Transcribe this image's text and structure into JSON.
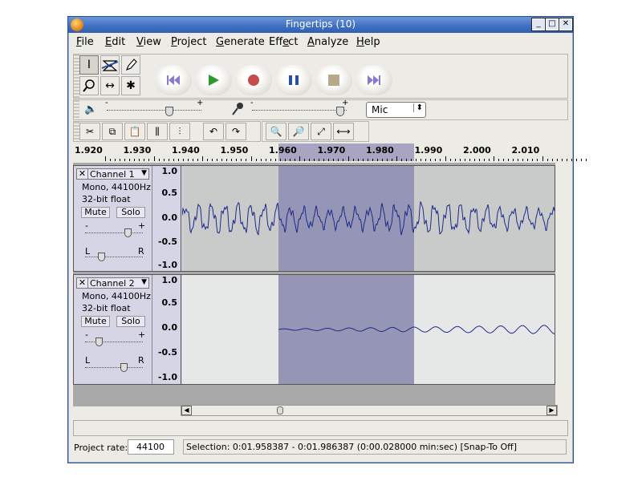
{
  "window": {
    "title": "Fingertips (10)",
    "controls": {
      "minimize": "_",
      "maximize": "□",
      "close": "✕"
    }
  },
  "menu": {
    "items": [
      {
        "label": "File",
        "key": "F",
        "rest": "ile"
      },
      {
        "label": "Edit",
        "key": "E",
        "rest": "dit"
      },
      {
        "label": "View",
        "key": "V",
        "rest": "iew"
      },
      {
        "label": "Project",
        "key": "P",
        "rest": "roject"
      },
      {
        "label": "Generate",
        "key": "G",
        "rest": "enerate"
      },
      {
        "label": "Effect",
        "key": "E",
        "pre": "Eff",
        "rest": "ect",
        "underline_index": 3
      },
      {
        "label": "Analyze",
        "key": "A",
        "rest": "nalyze"
      },
      {
        "label": "Help",
        "key": "H",
        "rest": "elp"
      }
    ]
  },
  "tools": {
    "selection": "I",
    "envelope": "envelope-icon",
    "draw": "pencil-icon",
    "zoom": "magnifier-icon",
    "timeshift": "↔",
    "multi": "✱"
  },
  "transport": {
    "colors": {
      "skip": "#8a7ad0",
      "play": "#2e9a2e",
      "record": "#c84a4a",
      "pause": "#2a4fa8",
      "stop": "#b8a88a"
    }
  },
  "mixer": {
    "output_volume": 0.68,
    "input_volume": 0.97,
    "input_source": "Mic",
    "output_scale": [
      "-",
      "+"
    ],
    "input_scale": [
      "-",
      "+"
    ]
  },
  "edit_toolbar": {
    "undo": "↶",
    "redo": "↷"
  },
  "ruler": {
    "labels": [
      "1.920",
      "1.930",
      "1.940",
      "1.950",
      "1.960",
      "1.970",
      "1.980",
      "1.990",
      "2.000",
      "2.010"
    ]
  },
  "tracks": [
    {
      "name": "Channel 1",
      "info1": "Mono, 44100Hz",
      "info2": "32-bit float",
      "mute": "Mute",
      "solo": "Solo",
      "gain_minus": "-",
      "gain_plus": "+",
      "pan_left": "L",
      "pan_right": "R",
      "gain": 0.78,
      "pan": 0.25,
      "scale": [
        "1.0",
        "0.5",
        "0.0",
        "-0.5",
        "-1.0"
      ]
    },
    {
      "name": "Channel 2",
      "info1": "Mono, 44100Hz",
      "info2": "32-bit float",
      "mute": "Mute",
      "solo": "Solo",
      "gain_minus": "-",
      "gain_plus": "+",
      "pan_left": "L",
      "pan_right": "R",
      "gain": 0.2,
      "pan": 0.7,
      "scale": [
        "1.0",
        "0.5",
        "0.0",
        "-0.5",
        "-1.0"
      ]
    }
  ],
  "status": {
    "rate_label": "Project rate:",
    "rate_value": "44100",
    "selection_text": "Selection: 0:01.958387 - 0:01.986387 (0:00.028000 min:sec)  [Snap-To Off]"
  },
  "colors": {
    "track_bg": "#c9cbcb",
    "selection": "#9595b5",
    "waveform": "#1c2a8a",
    "empty_bg": "#e6e8e8"
  }
}
